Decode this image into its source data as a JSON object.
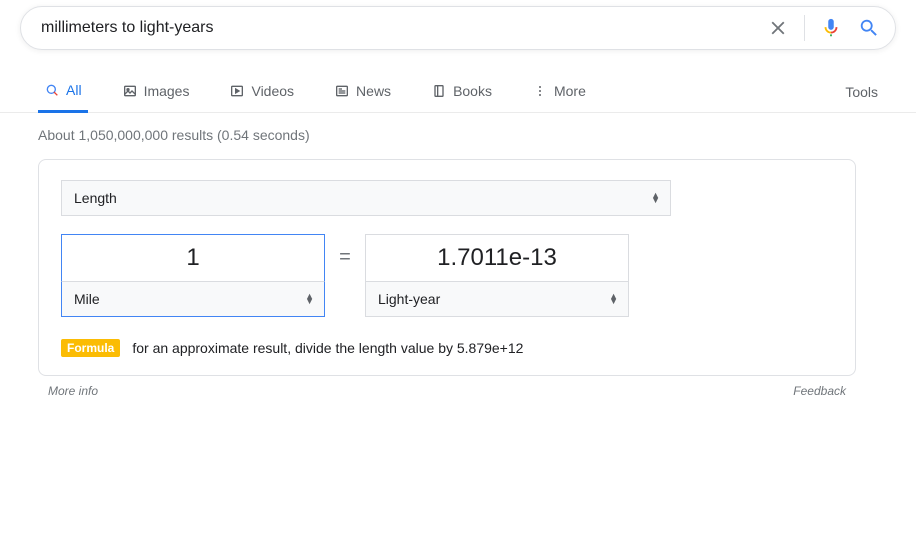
{
  "search": {
    "query": "millimeters to light-years"
  },
  "tabs": {
    "all": "All",
    "images": "Images",
    "videos": "Videos",
    "news": "News",
    "books": "Books",
    "more": "More",
    "tools": "Tools"
  },
  "stats": "About 1,050,000,000 results (0.54 seconds)",
  "converter": {
    "category": "Length",
    "from_value": "1",
    "from_unit": "Mile",
    "to_value": "1.7011e-13",
    "to_unit": "Light-year",
    "equals": "=",
    "badge": "Formula",
    "formula_text": "for an approximate result, divide the length value by 5.879e+12"
  },
  "footer": {
    "more_info": "More info",
    "feedback": "Feedback"
  }
}
